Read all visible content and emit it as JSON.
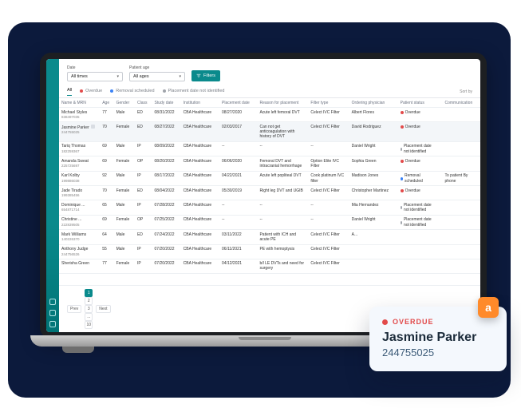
{
  "filters": {
    "date_label": "Date",
    "date_value": "All times",
    "age_label": "Patient age",
    "age_value": "All ages",
    "button": "Filters"
  },
  "tabs": {
    "all": "All",
    "overdue": "Overdue",
    "removal": "Removal scheduled",
    "placement": "Placement date not identified",
    "sort": "Sort by"
  },
  "columns": {
    "name": "Name & MRN",
    "age": "Age",
    "gender": "Gender",
    "class": "Class",
    "study": "Study date",
    "inst": "Institution",
    "place": "Placement date",
    "reason": "Reason for placement",
    "ftype": "Filter type",
    "phys": "Ordering physician",
    "pstatus": "Patient status",
    "comm": "Communication"
  },
  "rows": [
    {
      "name": "Michael Styles",
      "mrn": "838497035",
      "age": "77",
      "gender": "Male",
      "class": "ED",
      "study": "08/31/2022",
      "inst": "CBA Healthcare",
      "place": "08/27/2020",
      "reason": "Acute left femoral DVT",
      "ftype": "Celect IVC Filter",
      "phys": "Albert Flores",
      "status": "Overdue",
      "dot": "red",
      "comm": ""
    },
    {
      "name": "Jasmine Parker",
      "mrn": "244755025",
      "age": "70",
      "gender": "Female",
      "class": "ED",
      "study": "08/27/2022",
      "inst": "CBA Healthcare",
      "place": "02/03/2017",
      "reason": "Can not get anticoagulation with history of DVT",
      "ftype": "Celect IVC Filter",
      "phys": "David Rodriguez",
      "status": "Overdue",
      "dot": "red",
      "comm": ""
    },
    {
      "name": "Tariq Thomas",
      "mrn": "182259367",
      "age": "69",
      "gender": "Male",
      "class": "IP",
      "study": "08/09/2022",
      "inst": "CBA Healthcare",
      "place": "--",
      "reason": "--",
      "ftype": "--",
      "phys": "Daniel Wright",
      "status": "Placement date not identified",
      "dot": "grey",
      "comm": ""
    },
    {
      "name": "Amanda Sweat",
      "mrn": "225725697",
      "age": "69",
      "gender": "Female",
      "class": "OP",
      "study": "08/20/2022",
      "inst": "CBA Healthcare",
      "place": "06/06/2020",
      "reason": "Femoral DVT and intracranial hemorrhage",
      "ftype": "Option Elite IVC Filter",
      "phys": "Sophia Green",
      "status": "Overdue",
      "dot": "red",
      "comm": ""
    },
    {
      "name": "Karl Kolby",
      "mrn": "199886038",
      "age": "92",
      "gender": "Male",
      "class": "IP",
      "study": "08/17/2022",
      "inst": "CBA Healthcare",
      "place": "04/22/2021",
      "reason": "Acute left popliteal DVT",
      "ftype": "Cook platinum IVC filter",
      "phys": "Madison Jones",
      "status": "Removal scheduled",
      "dot": "blue",
      "comm": "To patient By phone"
    },
    {
      "name": "Jade Tirado",
      "mrn": "199385456",
      "age": "70",
      "gender": "Female",
      "class": "ED",
      "study": "08/04/2022",
      "inst": "CBA Healthcare",
      "place": "05/30/2019",
      "reason": "Right leg DVT and UGIB",
      "ftype": "Celect IVC Filter",
      "phys": "Christopher Martinez",
      "status": "Overdue",
      "dot": "red",
      "comm": ""
    },
    {
      "name": "Dominique ...",
      "mrn": "654871714",
      "age": "65",
      "gender": "Male",
      "class": "IP",
      "study": "07/28/2022",
      "inst": "CBA Healthcare",
      "place": "--",
      "reason": "--",
      "ftype": "--",
      "phys": "Mia Hernandez",
      "status": "Placement date not identified",
      "dot": "grey",
      "comm": ""
    },
    {
      "name": "Christine ...",
      "mrn": "222839505",
      "age": "69",
      "gender": "Female",
      "class": "OP",
      "study": "07/25/2022",
      "inst": "CBA Healthcare",
      "place": "--",
      "reason": "--",
      "ftype": "--",
      "phys": "Daniel Wright",
      "status": "Placement date not identified",
      "dot": "grey",
      "comm": ""
    },
    {
      "name": "Mark Williams",
      "mrn": "140226370",
      "age": "64",
      "gender": "Male",
      "class": "ED",
      "study": "07/24/2022",
      "inst": "CBA Healthcare",
      "place": "03/11/2022",
      "reason": "Patient with ICH and acute PE",
      "ftype": "Celect IVC Filter",
      "phys": "A...",
      "status": "",
      "dot": "",
      "comm": ""
    },
    {
      "name": "Anthony Judge",
      "mrn": "244756526",
      "age": "55",
      "gender": "Male",
      "class": "IP",
      "study": "07/20/2022",
      "inst": "CBA Healthcare",
      "place": "06/11/2021",
      "reason": "PE with hemoptysis",
      "ftype": "Celect IVC Filter",
      "phys": "",
      "status": "",
      "dot": "",
      "comm": ""
    },
    {
      "name": "Sherisha Green",
      "mrn": "",
      "age": "77",
      "gender": "Female",
      "class": "IP",
      "study": "07/20/2022",
      "inst": "CBA Healthcare",
      "place": "04/12/2021",
      "reason": "b/l LE DVTs and need for surgery",
      "ftype": "Celect IVC Filter",
      "phys": "",
      "status": "",
      "dot": "",
      "comm": ""
    }
  ],
  "pager": {
    "prev": "Prev",
    "pages": [
      "1",
      "2",
      "3",
      "...",
      "10"
    ],
    "next": "Next"
  },
  "card": {
    "status": "OVERDUE",
    "name": "Jasmine Parker",
    "mrn": "244755025",
    "badge": "a"
  }
}
